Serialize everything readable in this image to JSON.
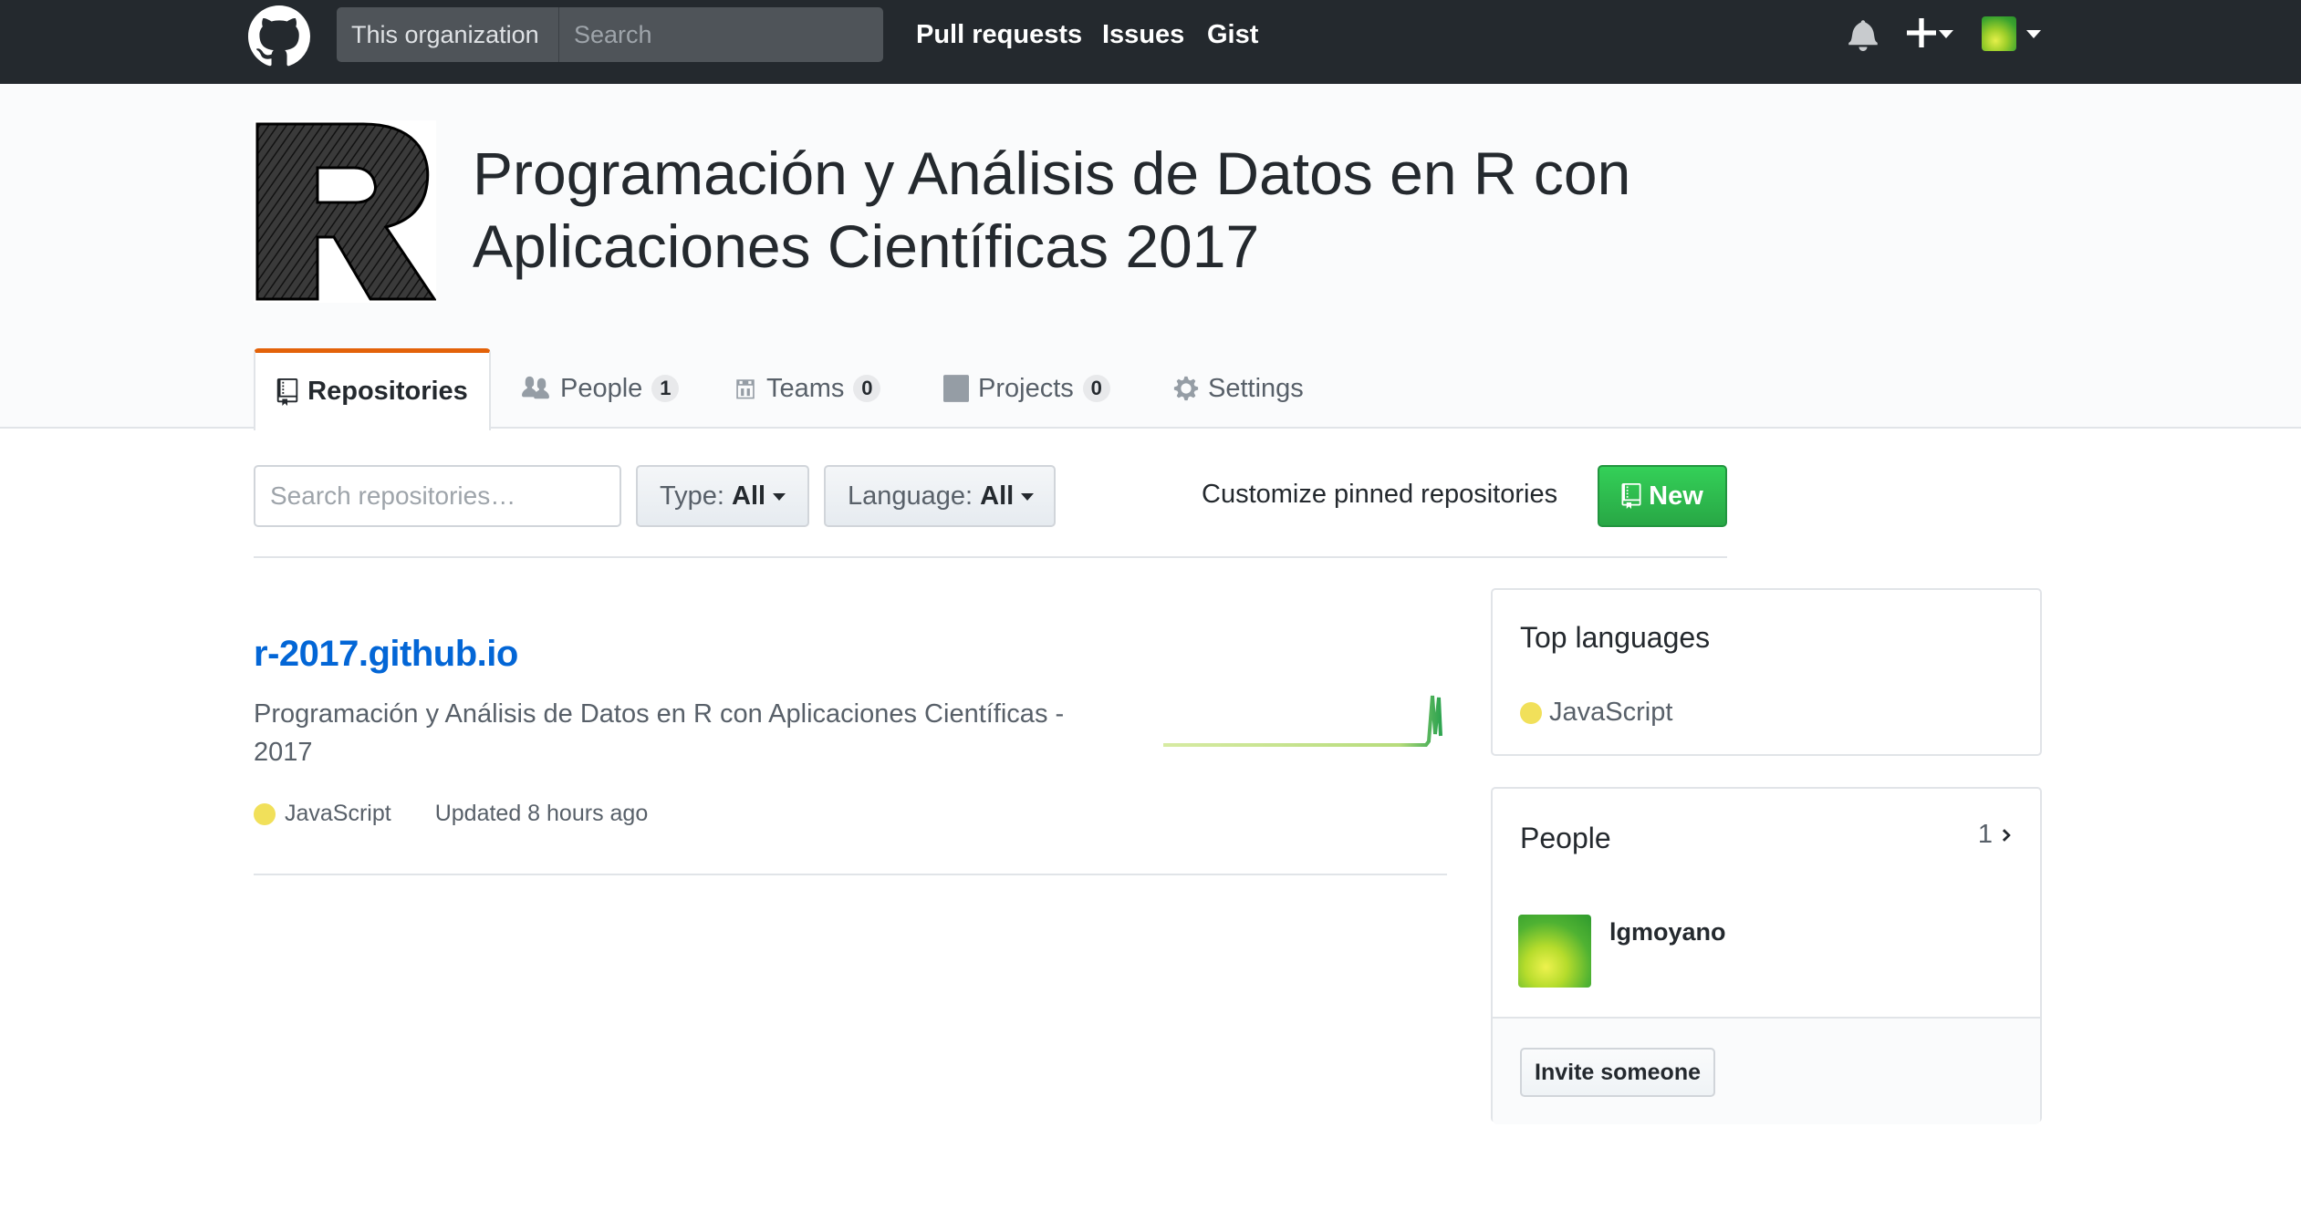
{
  "header": {
    "scope_label": "This organization",
    "search_placeholder": "Search",
    "nav": [
      "Pull requests",
      "Issues",
      "Gist"
    ],
    "icons": [
      "github-octocat-icon",
      "bell-icon",
      "plus-icon",
      "caret-down-icon",
      "avatar"
    ]
  },
  "org": {
    "logo_icon": "org-r-logo",
    "title": "Programación y Análisis de Datos en R con Aplicaciones Científicas 2017"
  },
  "tabs": [
    {
      "label": "Repositories",
      "icon": "repo-icon",
      "active": true,
      "count": null
    },
    {
      "label": "People",
      "icon": "people-icon",
      "active": false,
      "count": "1"
    },
    {
      "label": "Teams",
      "icon": "teams-icon",
      "active": false,
      "count": "0"
    },
    {
      "label": "Projects",
      "icon": "project-icon",
      "active": false,
      "count": "0"
    },
    {
      "label": "Settings",
      "icon": "gear-icon",
      "active": false,
      "count": null
    }
  ],
  "filters": {
    "search_placeholder": "Search repositories…",
    "type_label": "Type:",
    "type_value": "All",
    "language_label": "Language:",
    "language_value": "All",
    "customize_label": "Customize pinned repositories",
    "new_label": "New"
  },
  "repos": [
    {
      "name": "r-2017.github.io",
      "description": "Programación y Análisis de Datos en R con Aplicaciones Científicas - 2017",
      "language": "JavaScript",
      "language_color": "#f1e05a",
      "updated": "Updated 8 hours ago"
    }
  ],
  "sidebar": {
    "top_languages": {
      "title": "Top languages",
      "items": [
        {
          "name": "JavaScript",
          "color": "#f1e05a"
        }
      ]
    },
    "people": {
      "title": "People",
      "count": "1",
      "members": [
        {
          "login": "lgmoyano"
        }
      ],
      "invite_label": "Invite someone"
    }
  },
  "colors": {
    "header_bg": "#24292e",
    "link": "#0366d6",
    "active_tab_accent": "#e36209",
    "new_button": "#28a745"
  }
}
